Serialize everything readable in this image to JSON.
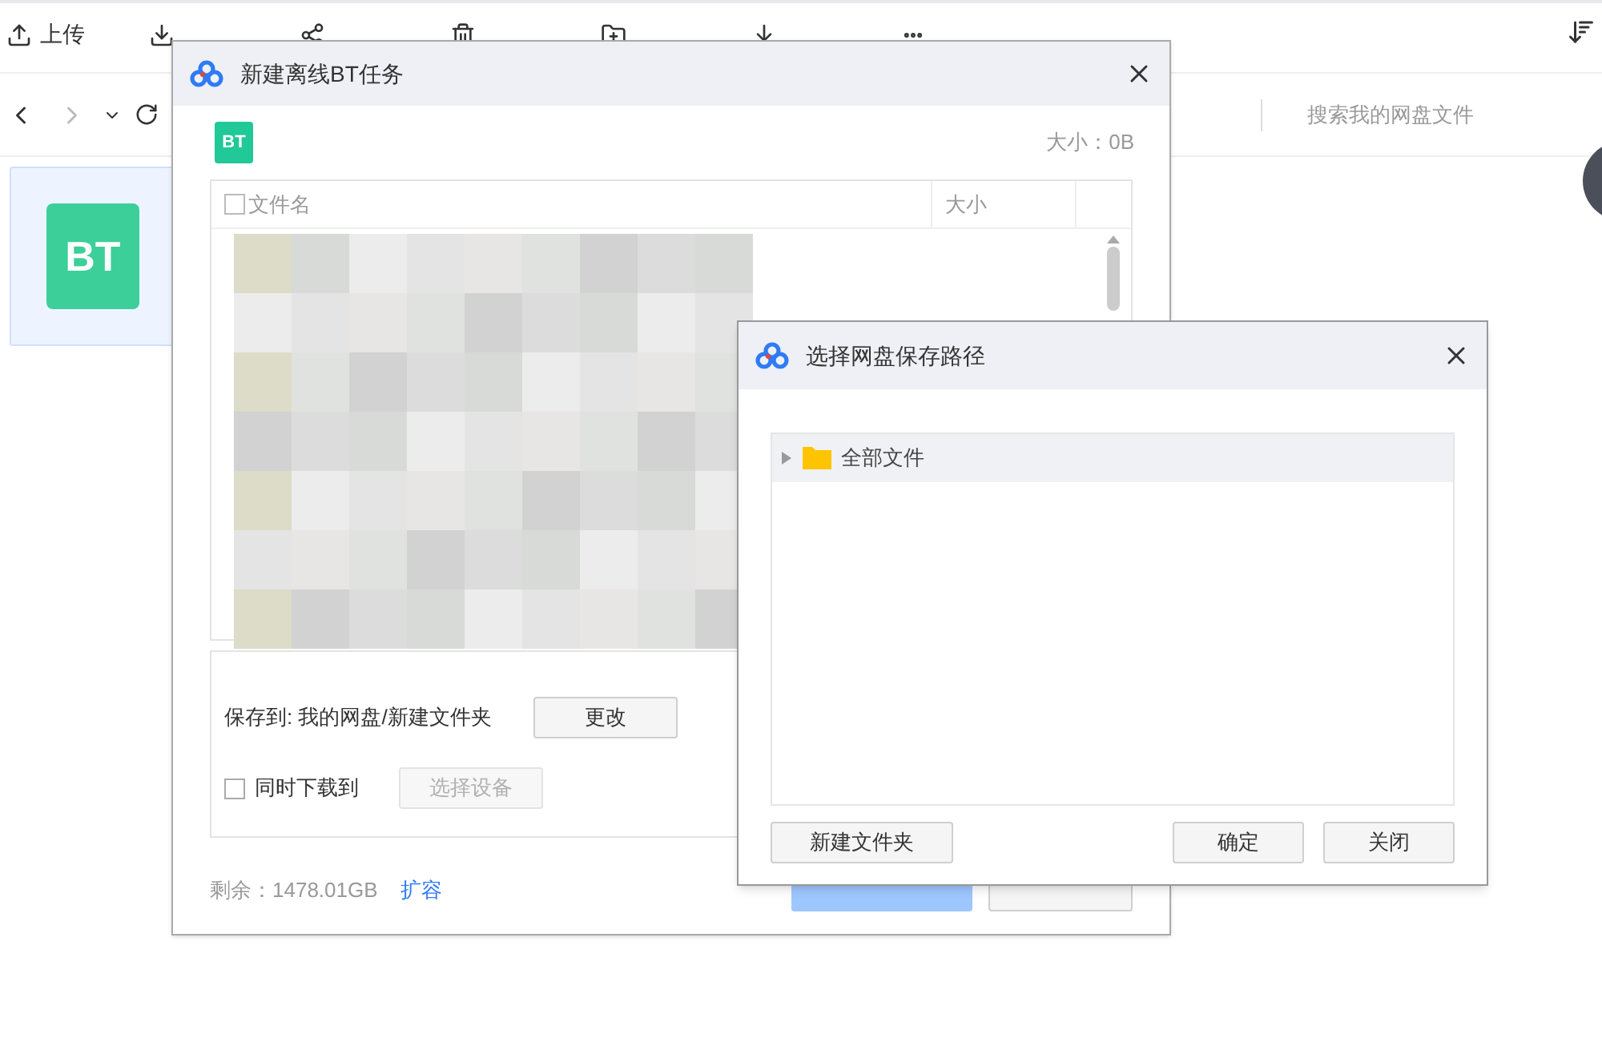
{
  "toolbar": {
    "items": [
      {
        "label": "上传",
        "kind": "upload"
      },
      {
        "kind": "download"
      },
      {
        "kind": "share"
      },
      {
        "kind": "delete"
      },
      {
        "kind": "folder"
      },
      {
        "kind": "offline"
      },
      {
        "kind": "more"
      }
    ]
  },
  "nav": {
    "search": {
      "placeholder": "搜索我的网盘文件"
    }
  },
  "files": [
    {
      "badge": "BT",
      "selected": true
    }
  ],
  "bt_dialog": {
    "title": "新建离线BT任务",
    "file_badge": "BT",
    "size": "大小：0B",
    "table": {
      "columns": [
        "文件名",
        "大小"
      ],
      "select_all_checked": false
    },
    "save_to": "保存到: 我的网盘/新建文件夹",
    "change_button": "更改",
    "also_download": {
      "label": "同时下载到",
      "checked": false
    },
    "select_device": {
      "label": "选择设备",
      "disabled": true
    },
    "remaining": "剩余：1478.01GB",
    "expand_link": "扩容",
    "start_button": {
      "disabled": true
    }
  },
  "path_dialog": {
    "title": "选择网盘保存路径",
    "tree": [
      {
        "label": "全部文件",
        "expanded": false,
        "selected": true
      }
    ],
    "buttons": [
      "新建文件夹",
      "确定",
      "关闭"
    ]
  }
}
